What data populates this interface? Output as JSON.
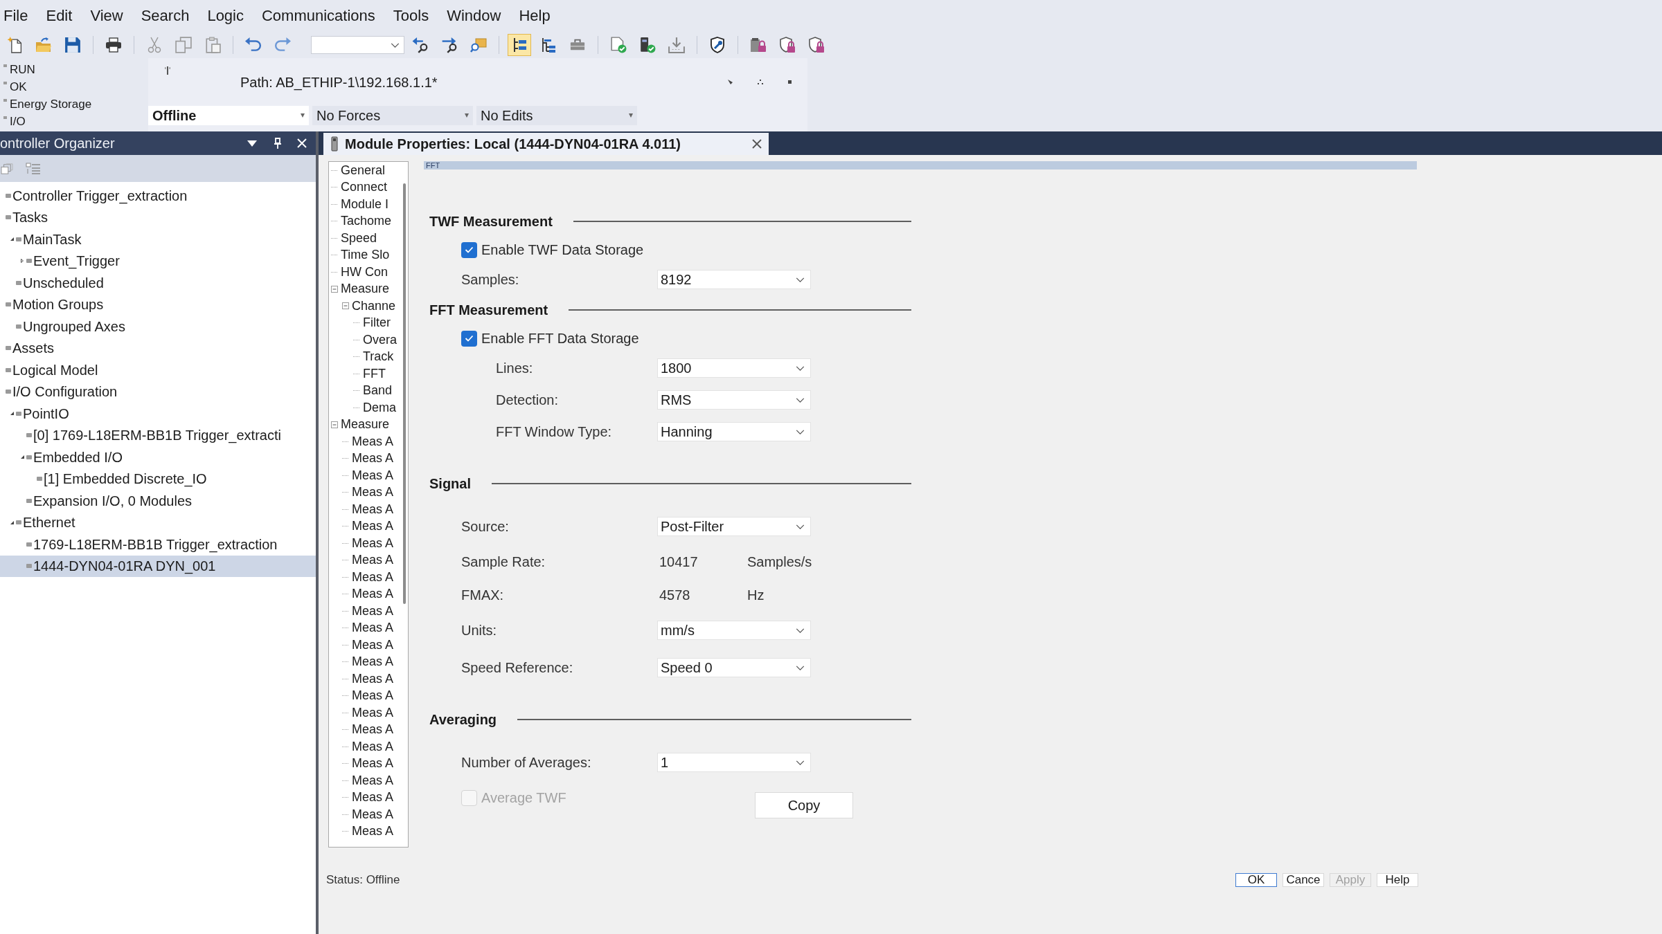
{
  "menu": [
    "File",
    "Edit",
    "View",
    "Search",
    "Logic",
    "Communications",
    "Tools",
    "Window",
    "Help"
  ],
  "toolbar": {
    "toggles": [
      {
        "on": true
      },
      {
        "on": false
      },
      {
        "on": false
      }
    ]
  },
  "controller_status": {
    "indicators": [
      {
        "label": "RUN",
        "on": false
      },
      {
        "label": "OK",
        "on": false
      },
      {
        "label": "Energy Storage",
        "on": false
      },
      {
        "label": "I/O",
        "on": false
      }
    ],
    "path": "Path: AB_ETHIP-1\\192.168.1.1*",
    "fields": [
      {
        "kind": "mode",
        "label": "Offline"
      },
      {
        "kind": "forces",
        "label": "No Forces"
      },
      {
        "kind": "edits",
        "label": "No Edits"
      }
    ]
  },
  "organizer": {
    "title": "ontroller Organizer",
    "tree": [
      {
        "label": "Controller Trigger_extraction",
        "selected": false
      },
      {
        "label": "Tasks",
        "selected": false,
        "children": [
          {
            "label": "MainTask",
            "selected": false,
            "expanded": true,
            "children": [
              {
                "label": "Event_Trigger",
                "selected": false,
                "expanded": false
              }
            ]
          },
          {
            "label": "Unscheduled",
            "selected": false
          }
        ]
      },
      {
        "label": "Motion Groups",
        "selected": false,
        "children": [
          {
            "label": "Ungrouped Axes",
            "selected": false
          }
        ]
      },
      {
        "label": "Assets",
        "selected": false
      },
      {
        "label": "Logical Model",
        "selected": false
      },
      {
        "label": "I/O Configuration",
        "selected": false,
        "children": [
          {
            "label": "PointIO",
            "selected": false,
            "expanded": true,
            "children": [
              {
                "label": "[0] 1769-L18ERM-BB1B Trigger_extracti",
                "selected": false
              },
              {
                "label": "Embedded I/O",
                "selected": false,
                "expanded": true,
                "children": [
                  {
                    "label": "[1] Embedded Discrete_IO",
                    "selected": false
                  }
                ]
              },
              {
                "label": "Expansion I/O, 0 Modules",
                "selected": false
              }
            ]
          },
          {
            "label": "Ethernet",
            "selected": false,
            "expanded": true,
            "children": [
              {
                "label": "1769-L18ERM-BB1B Trigger_extraction",
                "selected": false
              },
              {
                "label": "1444-DYN04-01RA DYN_001",
                "selected": true
              }
            ]
          }
        ]
      }
    ]
  },
  "document_tab": {
    "title": "Module Properties: Local (1444-DYN04-01RA 4.011)"
  },
  "dialog": {
    "nav": [
      {
        "label": "General"
      },
      {
        "label": "Connect"
      },
      {
        "label": "Module I"
      },
      {
        "label": "Tachome"
      },
      {
        "label": "Speed"
      },
      {
        "label": "Time Slo"
      },
      {
        "label": "HW Con"
      },
      {
        "label": "Measure",
        "expanded": true,
        "children": [
          {
            "label": "Channe",
            "expanded": true,
            "children": [
              {
                "label": "Filter"
              },
              {
                "label": "Overa"
              },
              {
                "label": "Track"
              },
              {
                "label": "FFT"
              },
              {
                "label": "Band"
              },
              {
                "label": "Dema"
              }
            ]
          }
        ]
      },
      {
        "label": "Measure",
        "expanded": true,
        "children": [
          {
            "label": "Meas A"
          },
          {
            "label": "Meas A"
          },
          {
            "label": "Meas A"
          },
          {
            "label": "Meas A"
          },
          {
            "label": "Meas A"
          },
          {
            "label": "Meas A"
          },
          {
            "label": "Meas A"
          },
          {
            "label": "Meas A"
          },
          {
            "label": "Meas A"
          },
          {
            "label": "Meas A"
          },
          {
            "label": "Meas A"
          },
          {
            "label": "Meas A"
          },
          {
            "label": "Meas A"
          },
          {
            "label": "Meas A"
          },
          {
            "label": "Meas A"
          },
          {
            "label": "Meas A"
          },
          {
            "label": "Meas A"
          },
          {
            "label": "Meas A"
          },
          {
            "label": "Meas A"
          },
          {
            "label": "Meas A"
          },
          {
            "label": "Meas A"
          },
          {
            "label": "Meas A"
          },
          {
            "label": "Meas A"
          },
          {
            "label": "Meas A"
          }
        ]
      }
    ],
    "page_title": "FFT",
    "sections": [
      {
        "title": "TWF Measurement",
        "rows": [
          {
            "kind": "checkbox",
            "label": "Enable TWF Data Storage",
            "checked": true,
            "disabled": false
          },
          {
            "kind": "dropdown",
            "label": "Samples:",
            "value": "8192"
          }
        ]
      },
      {
        "title": "FFT Measurement",
        "rows": [
          {
            "kind": "checkbox",
            "label": "Enable FFT Data Storage",
            "checked": true,
            "disabled": false,
            "children": [
              {
                "kind": "dropdown",
                "label": "Lines:",
                "value": "1800"
              },
              {
                "kind": "dropdown",
                "label": "Detection:",
                "value": "RMS"
              },
              {
                "kind": "dropdown",
                "label": "FFT Window Type:",
                "value": "Hanning"
              }
            ]
          }
        ]
      },
      {
        "title": "Signal",
        "rows": [
          {
            "kind": "dropdown",
            "label": "Source:",
            "value": "Post-Filter"
          },
          {
            "kind": "readout",
            "label": "Sample Rate:",
            "value": "10417",
            "unit": "Samples/s"
          },
          {
            "kind": "readout",
            "label": "FMAX:",
            "value": "4578",
            "unit": "Hz"
          },
          {
            "kind": "dropdown",
            "label": "Units:",
            "value": "mm/s"
          },
          {
            "kind": "dropdown",
            "label": "Speed Reference:",
            "value": "Speed 0"
          }
        ]
      },
      {
        "title": "Averaging",
        "rows": [
          {
            "kind": "dropdown",
            "label": "Number of Averages:",
            "value": "1"
          },
          {
            "kind": "checkbox",
            "label": "Average TWF",
            "checked": false,
            "disabled": true,
            "button": "Copy"
          }
        ]
      }
    ],
    "status": "Status: Offline",
    "buttons": [
      {
        "label": "OK",
        "default": true,
        "disabled": false
      },
      {
        "label": "Cance",
        "default": false,
        "disabled": false
      },
      {
        "label": "Apply",
        "default": false,
        "disabled": true
      },
      {
        "label": "Help",
        "default": false,
        "disabled": false
      }
    ]
  }
}
